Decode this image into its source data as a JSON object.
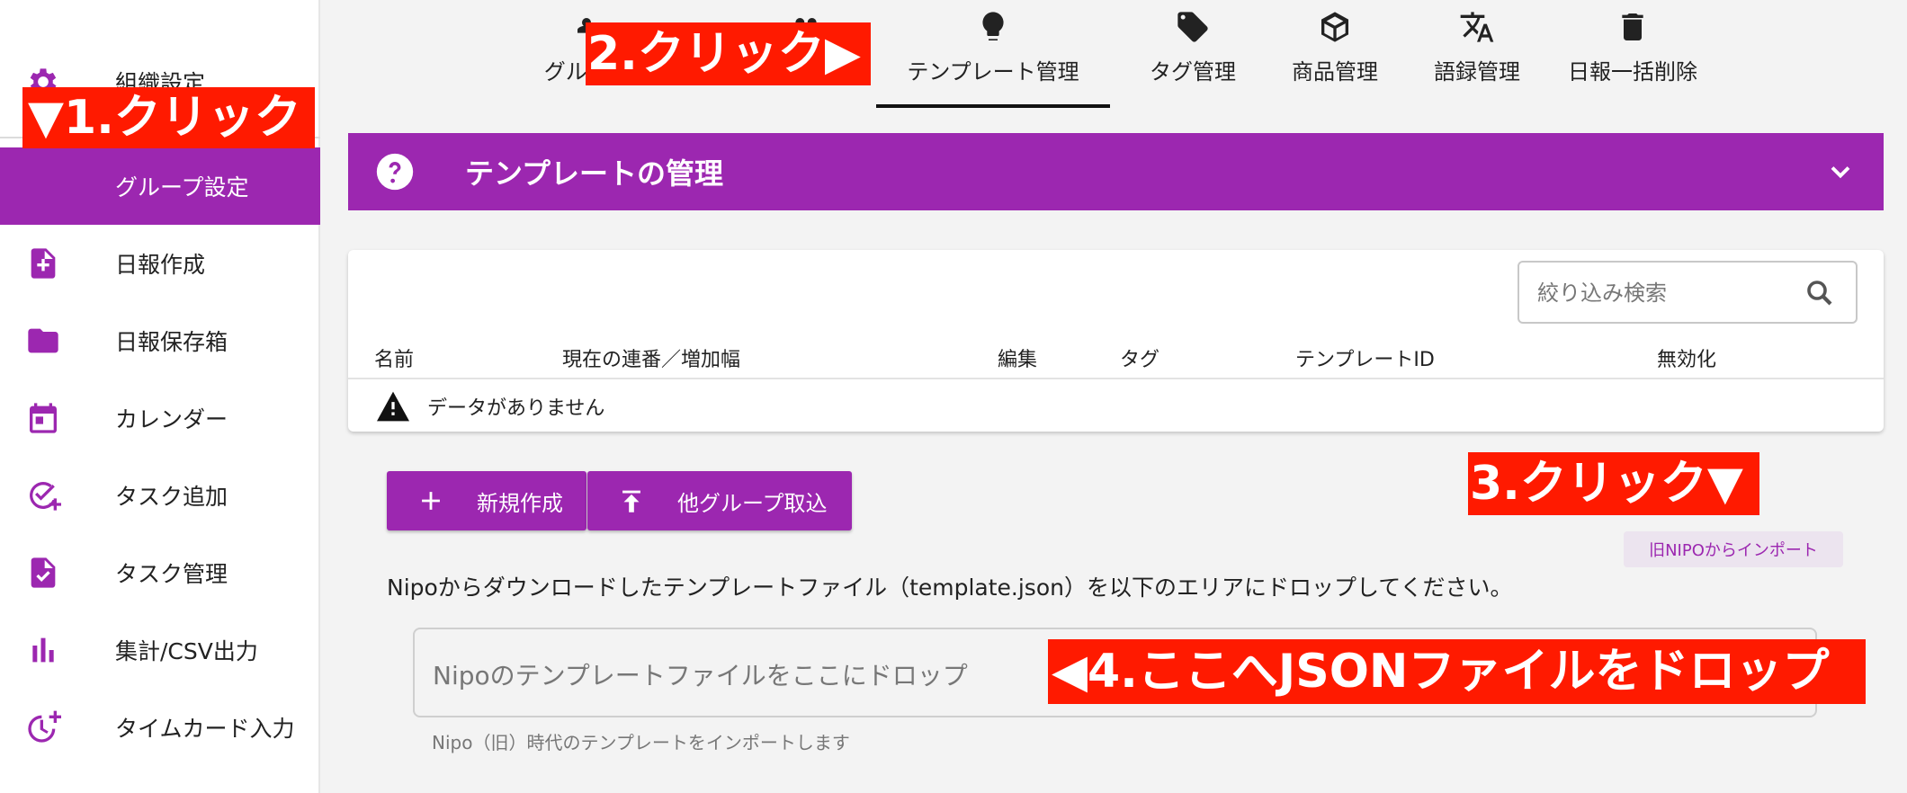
{
  "sidebar": {
    "items": [
      {
        "label": "組織設定"
      },
      {
        "label": "グループ設定"
      },
      {
        "label": "日報作成"
      },
      {
        "label": "日報保存箱"
      },
      {
        "label": "カレンダー"
      },
      {
        "label": "タスク追加"
      },
      {
        "label": "タスク管理"
      },
      {
        "label": "集計/CSV出力"
      },
      {
        "label": "タイムカード入力"
      }
    ]
  },
  "tabs": [
    {
      "label": "グループ"
    },
    {
      "label": "テンプレート管理",
      "active": true
    },
    {
      "label": "タグ管理"
    },
    {
      "label": "商品管理"
    },
    {
      "label": "語録管理"
    },
    {
      "label": "日報一括削除"
    }
  ],
  "section": {
    "title": "テンプレートの管理"
  },
  "table": {
    "filter_placeholder": "絞り込み検索",
    "columns": [
      "名前",
      "現在の連番／増加幅",
      "編集",
      "タグ",
      "テンプレートID",
      "無効化"
    ],
    "empty_message": "データがありません"
  },
  "buttons": {
    "new": "新規作成",
    "import_group": "他グループ取込",
    "import_legacy": "旧NIPOからインポート"
  },
  "import": {
    "description": "Nipoからダウンロードしたテンプレートファイル（template.json）を以下のエリアにドロップしてください。",
    "dropzone_placeholder": "Nipoのテンプレートファイルをここにドロップ",
    "hint": "Nipo（旧）時代のテンプレートをインポートします"
  },
  "annotations": {
    "step1": "▼1.クリック",
    "step2": "2.クリック▶",
    "step3": "3.クリック▼",
    "step4": "◀4.ここへJSONファイルをドロップ"
  },
  "colors": {
    "accent": "#9c27b0",
    "callout": "#ff1a00"
  }
}
